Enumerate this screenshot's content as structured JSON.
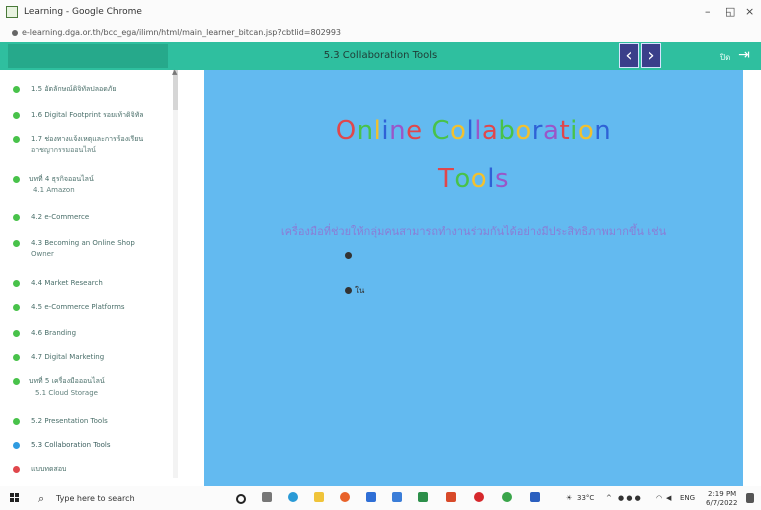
{
  "window": {
    "title": "Learning - Google Chrome",
    "url": "e-learning.dga.or.th/bcc_ega/ilimn/html/main_learner_bitcan.jsp?cbtlid=802993"
  },
  "header": {
    "title": "5.3 Collaboration Tools",
    "prev_glyph": "‹",
    "next_glyph": "›",
    "exit_glyph": "⇥",
    "exit_label": "ปิด"
  },
  "sidebar": {
    "items": [
      {
        "label": "1.5 อัตลักษณ์ดิจิทัลปลอดภัย",
        "status": "done"
      },
      {
        "label": "1.6 Digital Footprint รอยเท้าดิจิทัล",
        "status": "done"
      },
      {
        "label": "1.7 ช่องทางแจ้งเหตุและการร้องเรียน",
        "label2": "อาชญากรรมออนไลน์",
        "status": "done"
      },
      {
        "label": "บทที่ 4 ธุรกิจออนไลน์",
        "label2": "4.1 Amazon",
        "status": "done"
      },
      {
        "label": "4.2 e-Commerce",
        "status": "done"
      },
      {
        "label": "4.3 Becoming an Online Shop",
        "label2": "Owner",
        "status": "done"
      },
      {
        "label": "4.4 Market Research",
        "status": "done"
      },
      {
        "label": "4.5 e-Commerce Platforms",
        "status": "done"
      },
      {
        "label": "4.6 Branding",
        "status": "done"
      },
      {
        "label": "4.7 Digital Marketing",
        "status": "done"
      },
      {
        "label": "บทที่ 5 เครื่องมือออนไลน์",
        "label2": "5.1 Cloud Storage",
        "status": "done"
      },
      {
        "label": "5.2 Presentation Tools",
        "status": "done"
      },
      {
        "label": "5.3 Collaboration Tools",
        "status": "current"
      },
      {
        "label": "แบบทดสอบ",
        "status": "locked"
      }
    ]
  },
  "slide": {
    "title_line1": "Online Collaboration",
    "title_line2": "Tools",
    "subtitle": "เครื่องมือที่ช่วยให้กลุ่มคนสามารถทำงานร่วมกันได้อย่างมีประสิทธิภาพมากขึ้น เช่น",
    "bullet2_text": "ใน"
  },
  "taskbar": {
    "search_placeholder": "Type here to search",
    "weather": "33°C",
    "lang": "ENG",
    "time": "2:19 PM",
    "date": "6/7/2022"
  },
  "colors": {
    "header_bg": "#2fbf9f",
    "content_bg": "#63baf0",
    "done_dot": "#48c24a",
    "current_dot": "#2f9be0",
    "locked_dot": "#e0474c",
    "title_letters": [
      "#e0474c",
      "#48c24a",
      "#f2c12e",
      "#2f62d6",
      "#9a56c8"
    ]
  }
}
